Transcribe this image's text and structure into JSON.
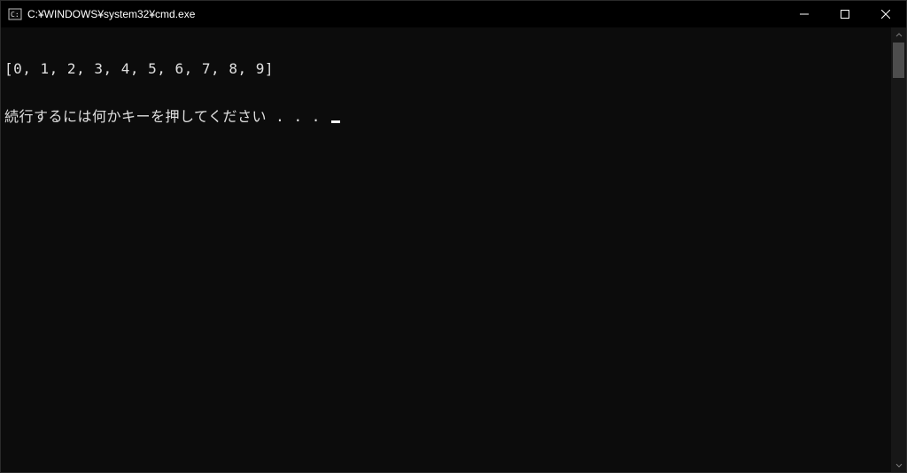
{
  "window": {
    "title": "C:¥WINDOWS¥system32¥cmd.exe"
  },
  "console": {
    "line1": "[0, 1, 2, 3, 4, 5, 6, 7, 8, 9]",
    "line2": "続行するには何かキーを押してください . . . "
  }
}
